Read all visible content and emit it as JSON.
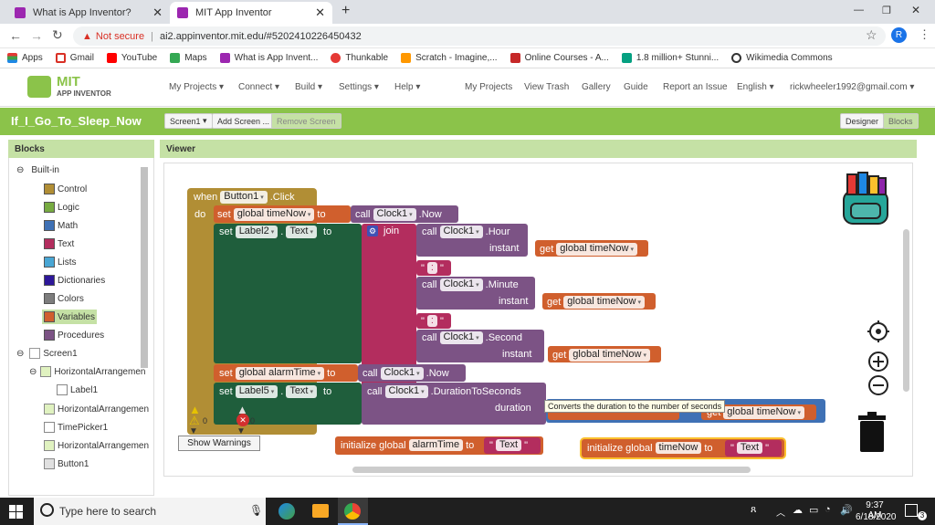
{
  "browser": {
    "tabs": [
      {
        "title": "What is App Inventor?"
      },
      {
        "title": "MIT App Inventor"
      }
    ],
    "new_tab": "+",
    "security": "Not secure",
    "url": "ai2.appinventor.mit.edu/#5202410226450432",
    "profile": "R",
    "bookmarks": [
      "Apps",
      "Gmail",
      "YouTube",
      "Maps",
      "What is App Invent...",
      "Thunkable",
      "Scratch - Imagine,...",
      "Online Courses - A...",
      "1.8 million+ Stunni...",
      "Wikimedia Commons"
    ]
  },
  "app": {
    "logo_top": "MIT",
    "logo_bottom": "APP INVENTOR",
    "menu": [
      "My Projects",
      "Connect",
      "Build",
      "Settings",
      "Help"
    ],
    "right_links": [
      "My Projects",
      "View Trash",
      "Gallery",
      "Guide",
      "Report an Issue",
      "English",
      "rickwheeler1992@gmail.com"
    ],
    "project_name": "If_I_Go_To_Sleep_Now",
    "screen_select": "Screen1",
    "add_screen": "Add Screen ...",
    "remove_screen": "Remove Screen",
    "designer": "Designer",
    "blocks_btn": "Blocks"
  },
  "blocks_panel": {
    "title": "Blocks",
    "builtin": "Built-in",
    "items": [
      {
        "label": "Control",
        "color": "#b18e35"
      },
      {
        "label": "Logic",
        "color": "#77ab41"
      },
      {
        "label": "Math",
        "color": "#3f71b5"
      },
      {
        "label": "Text",
        "color": "#b32d5e"
      },
      {
        "label": "Lists",
        "color": "#49a6d4"
      },
      {
        "label": "Dictionaries",
        "color": "#2d1799"
      },
      {
        "label": "Colors",
        "color": "#7d7d7d"
      },
      {
        "label": "Variables",
        "color": "#d05f2d"
      },
      {
        "label": "Procedures",
        "color": "#7c5385"
      }
    ],
    "components": [
      {
        "label": "Screen1"
      },
      {
        "label": "HorizontalArrangemen"
      },
      {
        "label": "Label1"
      },
      {
        "label": "HorizontalArrangemen"
      },
      {
        "label": "TimePicker1"
      },
      {
        "label": "HorizontalArrangemen"
      },
      {
        "label": "Button1"
      }
    ]
  },
  "viewer": {
    "title": "Viewer",
    "show_warnings": "Show Warnings",
    "warning_count": "0",
    "error_count": "0",
    "tooltip": "Converts the duration to the number of seconds",
    "blocks": {
      "when": "when",
      "button1": "Button1",
      "click": ".Click",
      "do": "do",
      "set": "set",
      "to": "to",
      "call": "call",
      "get": "get",
      "join": "join",
      "global_timenow": "global timeNow",
      "global_alarmtime": "global alarmTime",
      "clock1": "Clock1",
      "now": ".Now",
      "hour": ".Hour",
      "minute": ".Minute",
      "second": ".Second",
      "instant": "instant",
      "label2": "Label2",
      "label5": "Label5",
      "text_prop": "Text",
      "colon": ":",
      "duration_to_seconds": ".DurationToSeconds",
      "duration": "duration",
      "init_global": "initialize global",
      "alarmtime": "alarmTime",
      "timenow": "timeNow",
      "text_val": "Text",
      "hidden_partial": "global alarmTime"
    }
  },
  "taskbar": {
    "search": "Type here to search",
    "time": "9:37 AM",
    "date": "6/18/2020",
    "notifications": "3"
  }
}
